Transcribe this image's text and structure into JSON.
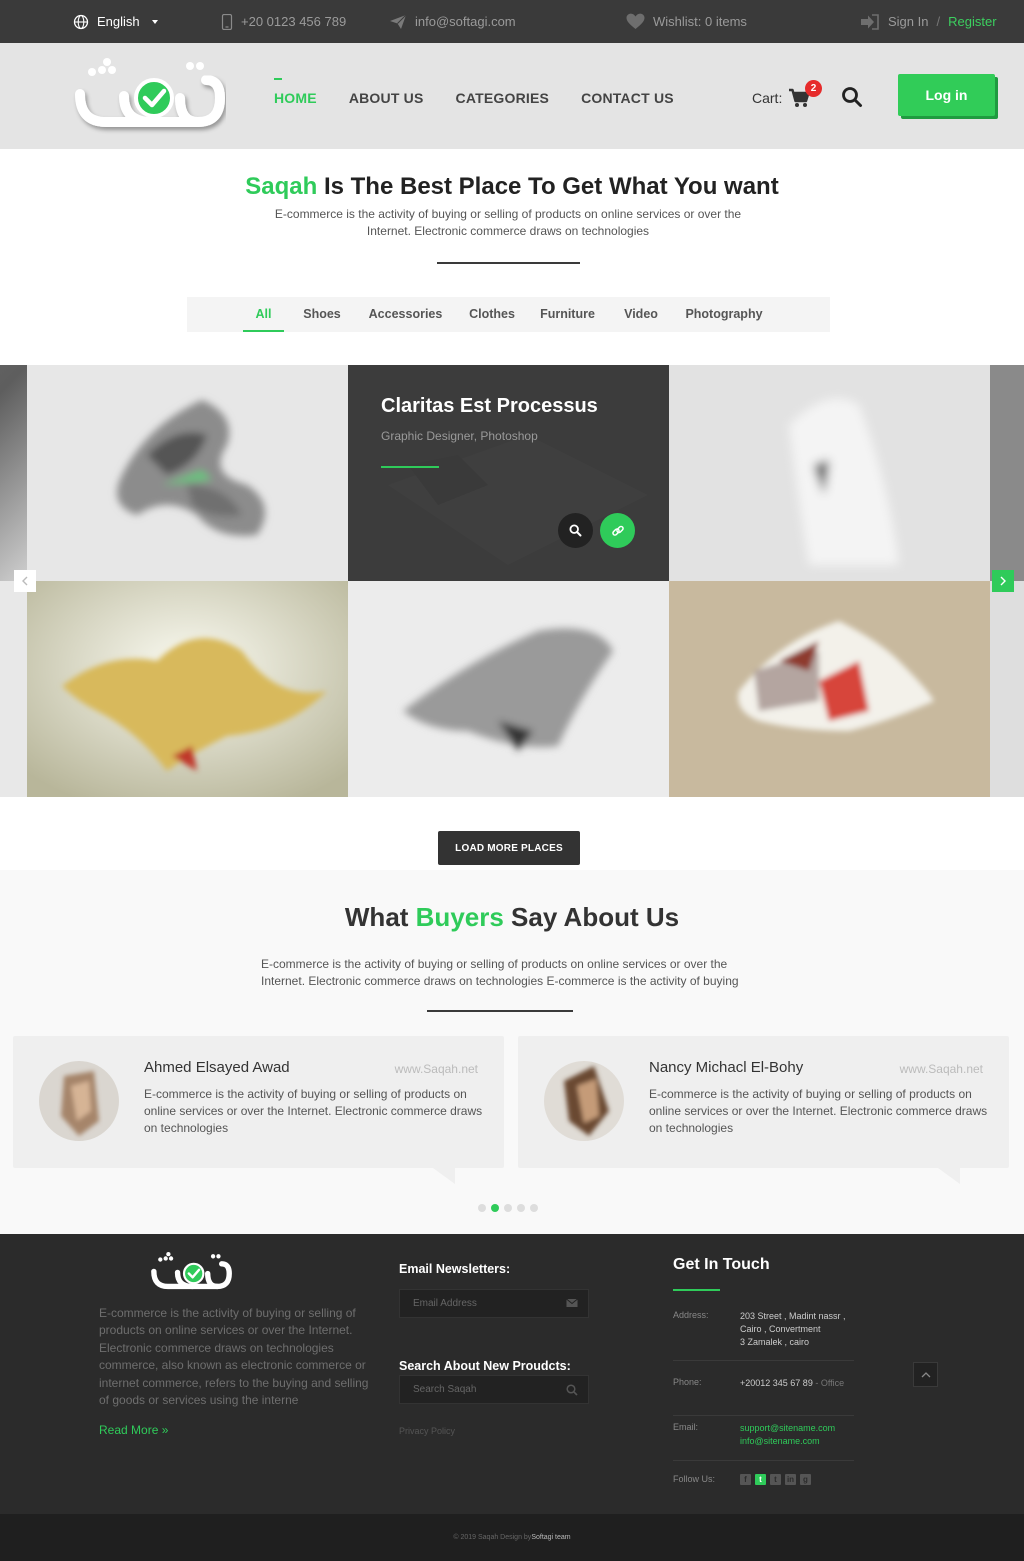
{
  "topbar": {
    "language": "English",
    "phone": "+20 0123 456 789",
    "email": "info@softagi.com",
    "wishlist": "Wishlist: 0 items",
    "sign_in": "Sign In",
    "separator": "/",
    "register": "Register"
  },
  "header": {
    "nav": [
      "HOME",
      "ABOUT US",
      "CATEGORIES",
      "CONTACT US"
    ],
    "cart_label": "Cart:",
    "cart_count": "2",
    "login": "Log in"
  },
  "intro": {
    "title_highlight": "Saqah",
    "title_rest": " Is The Best Place To Get What You want",
    "subtitle": "E-commerce is the activity of buying or selling of products on online services or over the Internet. Electronic commerce draws on technologies"
  },
  "tabs": [
    "All",
    "Shoes",
    "Accessories",
    "Clothes",
    "Furniture",
    "Video",
    "Photography"
  ],
  "gallery": {
    "overlay_title": "Claritas Est Processus",
    "overlay_sub": "Graphic Designer, Photoshop",
    "load_more": "LOAD MORE PLACES"
  },
  "testimonials": {
    "title_pre": "What ",
    "title_highlight": "Buyers",
    "title_post": " Say About Us",
    "subtitle": "E-commerce is the activity of buying or selling of products on online services or over the Internet. Electronic commerce draws on technologies E-commerce is the activity of buying",
    "cards": [
      {
        "name": "Ahmed Elsayed Awad",
        "site": "www.Saqah.net",
        "text": "E-commerce is the activity of buying or selling of products on online services or over the Internet. Electronic commerce draws on technologies"
      },
      {
        "name": "Nancy Michacl El-Bohy",
        "site": "www.Saqah.net",
        "text": "E-commerce is the activity of buying or selling of products on online services or over the Internet. Electronic commerce draws on technologies"
      }
    ]
  },
  "footer": {
    "about": "E-commerce is the activity of buying or selling of products on online services or over the Internet. Electronic commerce draws on technologies commerce, also known as electronic commerce or internet commerce, refers to the buying and selling of goods or services using the interne",
    "read_more": "Read More »",
    "newsletter_title": "Email Newsletters:",
    "newsletter_placeholder": "Email Address",
    "search_title": "Search About New Proudcts:",
    "search_placeholder": "Search Saqah",
    "privacy": "Privacy Policy",
    "touch_title": "Get In Touch",
    "address_label": "Address:",
    "address_line1": "203 Street , Madint nassr ,",
    "address_line2": "Cairo , Convertment",
    "address_line3": "3 Zamalek , cairo",
    "phone_label": "Phone:",
    "phone_value": "+20012 345 67 89",
    "phone_note": " - Office",
    "email_label": "Email:",
    "email_1": "support@sitename.com",
    "email_2": "info@sitename.com",
    "follow_label": "Follow Us:",
    "copyright_pre": "© 2019 Saqah Design by ",
    "copyright_team": "Softagi team"
  },
  "colors": {
    "accent": "#2fcb5a",
    "dark": "#3a3a3a",
    "badge": "#e62b2b"
  }
}
